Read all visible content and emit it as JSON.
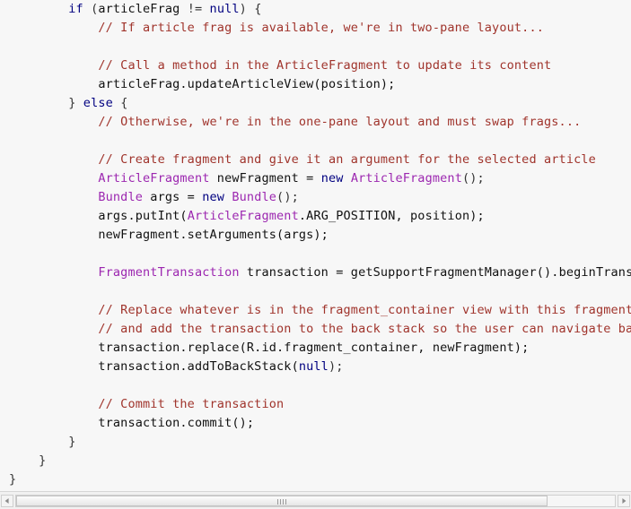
{
  "editor": {
    "background_color": "#f7f7f7",
    "language": "java",
    "colors": {
      "keyword": "#000080",
      "class_name": "#9c27b0",
      "comment": "#a0342c",
      "plain": "#111111"
    },
    "lines": [
      {
        "indent": 2,
        "tokens": [
          {
            "t": "if",
            "k": "kw"
          },
          {
            "t": " (",
            "k": "pun"
          },
          {
            "t": "articleFrag",
            "k": "pln"
          },
          {
            "t": " != ",
            "k": "pun"
          },
          {
            "t": "null",
            "k": "kw"
          },
          {
            "t": ") {",
            "k": "pun"
          }
        ]
      },
      {
        "indent": 3,
        "tokens": [
          {
            "t": "// If article frag is available, we're in two-pane layout...",
            "k": "cmt"
          }
        ]
      },
      {
        "indent": 0,
        "tokens": []
      },
      {
        "indent": 3,
        "tokens": [
          {
            "t": "// Call a method in the ArticleFragment to update its content",
            "k": "cmt"
          }
        ]
      },
      {
        "indent": 3,
        "tokens": [
          {
            "t": "articleFrag.updateArticleView(position);",
            "k": "pln"
          }
        ]
      },
      {
        "indent": 2,
        "tokens": [
          {
            "t": "} ",
            "k": "pun"
          },
          {
            "t": "else",
            "k": "kw"
          },
          {
            "t": " {",
            "k": "pun"
          }
        ]
      },
      {
        "indent": 3,
        "tokens": [
          {
            "t": "// Otherwise, we're in the one-pane layout and must swap frags...",
            "k": "cmt"
          }
        ]
      },
      {
        "indent": 0,
        "tokens": []
      },
      {
        "indent": 3,
        "tokens": [
          {
            "t": "// Create fragment and give it an argument for the selected article",
            "k": "cmt"
          }
        ]
      },
      {
        "indent": 3,
        "tokens": [
          {
            "t": "ArticleFragment",
            "k": "cls"
          },
          {
            "t": " newFragment = ",
            "k": "pln"
          },
          {
            "t": "new",
            "k": "kw"
          },
          {
            "t": " ",
            "k": "pln"
          },
          {
            "t": "ArticleFragment",
            "k": "cls"
          },
          {
            "t": "();",
            "k": "pun"
          }
        ]
      },
      {
        "indent": 3,
        "tokens": [
          {
            "t": "Bundle",
            "k": "cls"
          },
          {
            "t": " args = ",
            "k": "pln"
          },
          {
            "t": "new",
            "k": "kw"
          },
          {
            "t": " ",
            "k": "pln"
          },
          {
            "t": "Bundle",
            "k": "cls"
          },
          {
            "t": "();",
            "k": "pun"
          }
        ]
      },
      {
        "indent": 3,
        "tokens": [
          {
            "t": "args.putInt(",
            "k": "pln"
          },
          {
            "t": "ArticleFragment",
            "k": "cls"
          },
          {
            "t": ".ARG_POSITION, position);",
            "k": "pln"
          }
        ]
      },
      {
        "indent": 3,
        "tokens": [
          {
            "t": "newFragment.setArguments(args);",
            "k": "pln"
          }
        ]
      },
      {
        "indent": 0,
        "tokens": []
      },
      {
        "indent": 3,
        "tokens": [
          {
            "t": "FragmentTransaction",
            "k": "cls"
          },
          {
            "t": " transaction = getSupportFragmentManager().beginTransac",
            "k": "pln"
          }
        ]
      },
      {
        "indent": 0,
        "tokens": []
      },
      {
        "indent": 3,
        "tokens": [
          {
            "t": "// Replace whatever is in the fragment_container view with this fragment,",
            "k": "cmt"
          }
        ]
      },
      {
        "indent": 3,
        "tokens": [
          {
            "t": "// and add the transaction to the back stack so the user can navigate bacl",
            "k": "cmt"
          }
        ]
      },
      {
        "indent": 3,
        "tokens": [
          {
            "t": "transaction.replace(R.id.fragment_container, newFragment);",
            "k": "pln"
          }
        ]
      },
      {
        "indent": 3,
        "tokens": [
          {
            "t": "transaction.addToBackStack(",
            "k": "pln"
          },
          {
            "t": "null",
            "k": "kw"
          },
          {
            "t": ");",
            "k": "pun"
          }
        ]
      },
      {
        "indent": 0,
        "tokens": []
      },
      {
        "indent": 3,
        "tokens": [
          {
            "t": "// Commit the transaction",
            "k": "cmt"
          }
        ]
      },
      {
        "indent": 3,
        "tokens": [
          {
            "t": "transaction.commit();",
            "k": "pln"
          }
        ]
      },
      {
        "indent": 2,
        "tokens": [
          {
            "t": "}",
            "k": "pun"
          }
        ]
      },
      {
        "indent": 1,
        "tokens": [
          {
            "t": "}",
            "k": "pun"
          }
        ]
      },
      {
        "indent": 0,
        "tokens": [
          {
            "t": "}",
            "k": "pun"
          }
        ]
      }
    ]
  },
  "scrollbar": {
    "orientation": "horizontal",
    "left_arrow_icon": "triangle-left-icon",
    "right_arrow_icon": "triangle-right-icon",
    "thumb_grip_icon": "grip-dots-icon"
  }
}
